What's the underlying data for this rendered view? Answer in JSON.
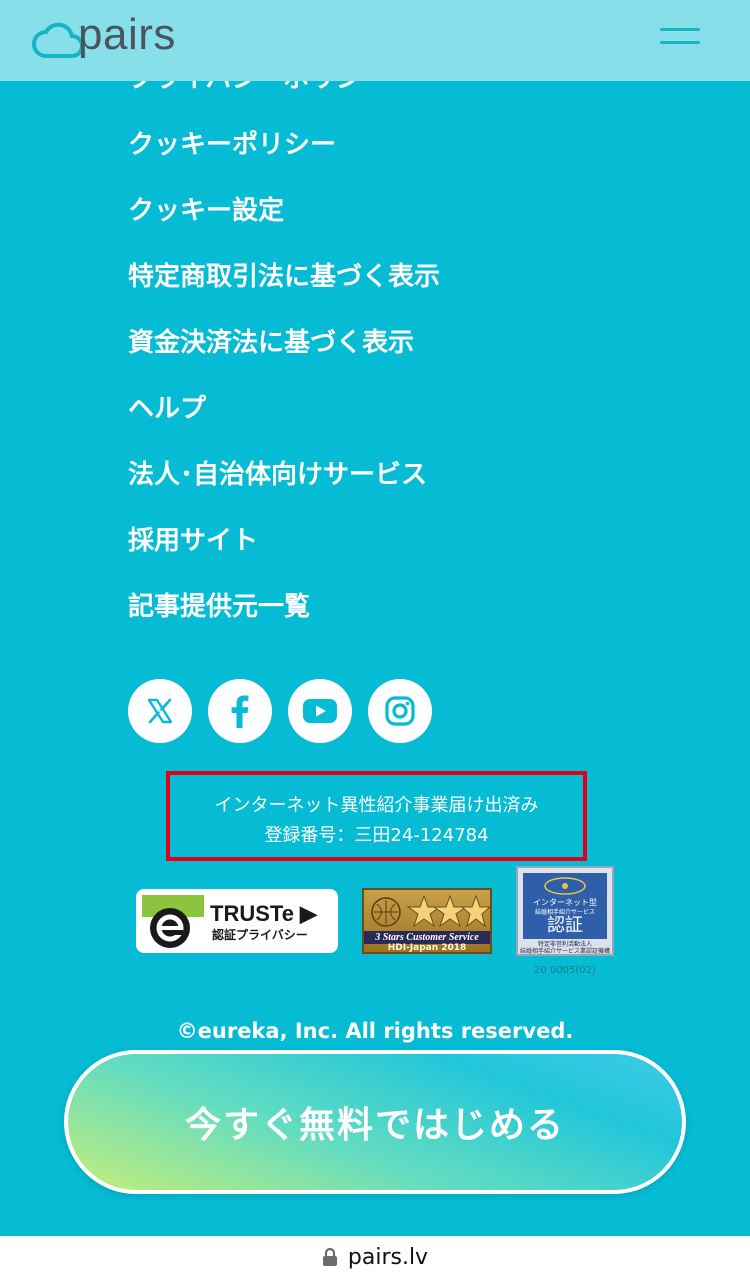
{
  "header": {
    "logo_text": "pairs",
    "menu_icon": "hamburger-menu-icon"
  },
  "footer_links": {
    "cut_off": "プライバシーポリシー",
    "items": [
      "クッキーポリシー",
      "クッキー設定",
      "特定商取引法に基づく表示",
      "資金決済法に基づく表示",
      "ヘルプ",
      "法人･自治体向けサービス",
      "採用サイト",
      "記事提供元一覧"
    ]
  },
  "social": [
    "x-icon",
    "facebook-icon",
    "youtube-icon",
    "instagram-icon"
  ],
  "notice": {
    "line1": "インターネット異性紹介事業届け出済み",
    "line2": "登録番号：三田24-124784"
  },
  "badges": {
    "truste_title": "TRUSTe ▶",
    "truste_sub": "認証プライバシー",
    "hdi_line1": "3 Stars Customer Service",
    "hdi_line2": "HDI-Japan 2018",
    "mark_t1": "インターネット型",
    "mark_t2": "結婚相手紹介サービス",
    "mark_t3": "認証",
    "mark_t4a": "特定非営利活動法人",
    "mark_t4b": "結婚相手紹介サービス業認証機構",
    "mark_code": "20 0005(02)"
  },
  "copyright": "©eureka, Inc. All rights reserved.",
  "cta_label": "今すぐ無料ではじめる",
  "browser": {
    "url": "pairs.lv"
  },
  "colors": {
    "background": "#05bcd4",
    "header": "#86dfe9",
    "notice_border": "#e0001a"
  }
}
